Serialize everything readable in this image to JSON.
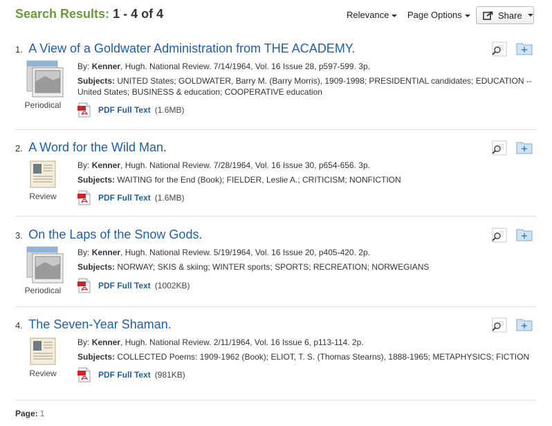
{
  "header": {
    "results_label": "Search Results:",
    "results_count": "1 - 4 of 4",
    "relevance_label": "Relevance",
    "page_options_label": "Page Options",
    "share_label": "Share"
  },
  "results": [
    {
      "number": "1.",
      "title": "A View of a Goldwater Administration from THE ACADEMY.",
      "by_label": "By:",
      "author_last": "Kenner",
      "citation": ", Hugh. National Review. 7/14/1964, Vol. 16 Issue 28, p597-599. 3p.",
      "subjects_label": "Subjects:",
      "subjects": "UNITED States; GOLDWATER, Barry M. (Barry Morris), 1909-1998; PRESIDENTIAL candidates; EDUCATION -- United States; BUSINESS & education; COOPERATIVE education",
      "pdf_label": "PDF Full Text",
      "pdf_size": "(1.6MB)",
      "type": "Periodical",
      "type_icon": "periodical-icon"
    },
    {
      "number": "2.",
      "title": "A Word for the Wild Man.",
      "by_label": "By:",
      "author_last": "Kenner",
      "citation": ", Hugh. National Review. 7/28/1964, Vol. 16 Issue 30, p654-656. 3p.",
      "subjects_label": "Subjects:",
      "subjects": "WAITING for the End (Book); FIELDER, Leslie A.; CRITICISM; NONFICTION",
      "pdf_label": "PDF Full Text",
      "pdf_size": "(1.6MB)",
      "type": "Review",
      "type_icon": "review-icon"
    },
    {
      "number": "3.",
      "title": "On the Laps of the Snow Gods.",
      "by_label": "By:",
      "author_last": "Kenner",
      "citation": ", Hugh. National Review. 5/19/1964, Vol. 16 Issue 20, p405-420. 2p.",
      "subjects_label": "Subjects:",
      "subjects": "NORWAY; SKIS & skiing; WINTER sports; SPORTS; RECREATION; NORWEGIANS",
      "pdf_label": "PDF Full Text",
      "pdf_size": "(1002KB)",
      "type": "Periodical",
      "type_icon": "periodical-icon"
    },
    {
      "number": "4.",
      "title": "The Seven-Year Shaman.",
      "by_label": "By:",
      "author_last": "Kenner",
      "citation": ", Hugh. National Review. 2/11/1964, Vol. 16 Issue 6, p113-114. 2p.",
      "subjects_label": "Subjects:",
      "subjects": "COLLECTED Poems: 1909-1962 (Book); ELIOT, T. S. (Thomas Stearns), 1888-1965; METAPHYSICS; FICTION",
      "pdf_label": "PDF Full Text",
      "pdf_size": "(981KB)",
      "type": "Review",
      "type_icon": "review-icon"
    }
  ],
  "footer": {
    "page_label": "Page:",
    "page_number": "1"
  },
  "colors": {
    "accent_green": "#6a9a3a",
    "link_blue": "#1f5fa8",
    "pdf_red": "#c8262b",
    "folder_blue": "#9cc3e6"
  }
}
